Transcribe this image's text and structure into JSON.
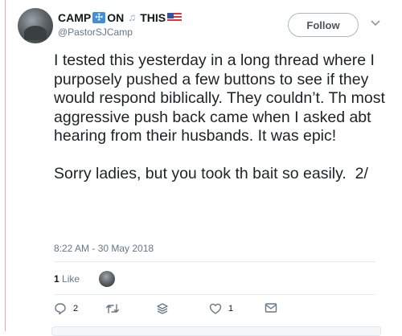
{
  "user": {
    "display_name_part1": "CAMP",
    "cross_icon_glyph": "☩",
    "display_name_part2": "ON",
    "notes_icon_glyph": "♫",
    "display_name_part3": "THIS",
    "handle": "@PastorSJCamp"
  },
  "header": {
    "follow_label": "Follow"
  },
  "tweet": {
    "text": "I tested this yesterday in a long thread where I purposely pushed a few buttons to see if they would respond biblically. They couldn’t. Th most aggressive push back came when I asked abt hearing from their husbands. It was epic!\n\nSorry ladies, but you took th bait so easily.  2/",
    "timestamp": "8:22 AM - 30 May 2018"
  },
  "stats": {
    "likes_number": "1",
    "likes_word": "Like"
  },
  "actions": {
    "reply_count": "2",
    "retweet_count": "",
    "like_count": "1"
  },
  "colors": {
    "text": "#14171a",
    "muted": "#657786",
    "thread_line": "#e6a5a5"
  }
}
